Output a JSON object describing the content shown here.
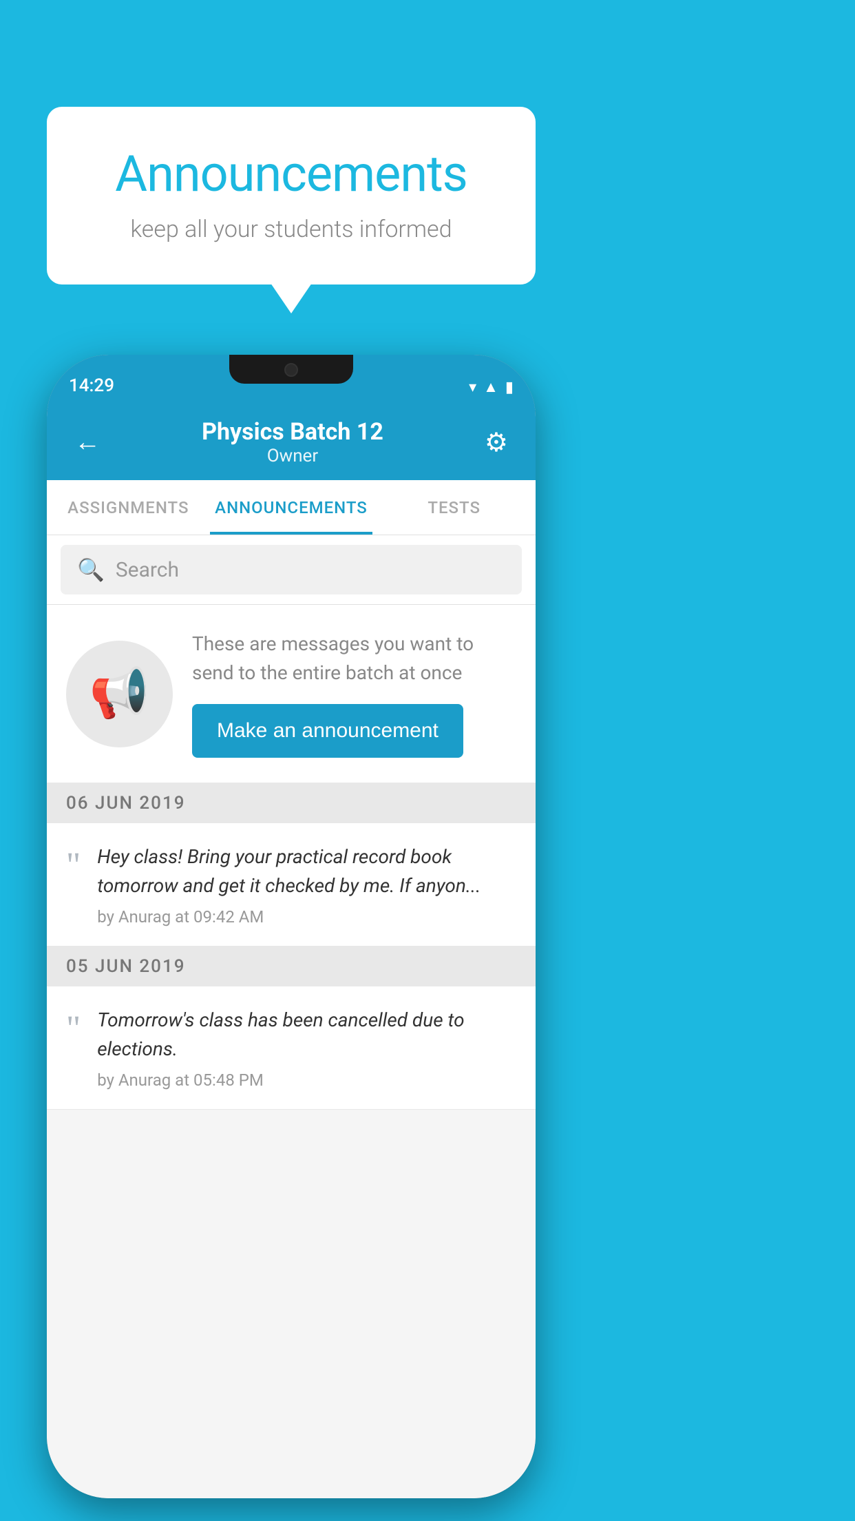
{
  "background_color": "#1cb8e0",
  "speech_bubble": {
    "title": "Announcements",
    "subtitle": "keep all your students informed"
  },
  "phone": {
    "status_bar": {
      "time": "14:29",
      "icons": [
        "wifi",
        "signal",
        "battery"
      ]
    },
    "header": {
      "title": "Physics Batch 12",
      "subtitle": "Owner",
      "back_label": "←",
      "gear_label": "⚙"
    },
    "tabs": [
      {
        "label": "ASSIGNMENTS",
        "active": false
      },
      {
        "label": "ANNOUNCEMENTS",
        "active": true
      },
      {
        "label": "TESTS",
        "active": false
      }
    ],
    "search": {
      "placeholder": "Search"
    },
    "promo": {
      "description": "These are messages you want to send to the entire batch at once",
      "button_label": "Make an announcement"
    },
    "announcements": [
      {
        "date": "06  JUN  2019",
        "text": "Hey class! Bring your practical record book tomorrow and get it checked by me. If anyon...",
        "meta": "by Anurag at 09:42 AM"
      },
      {
        "date": "05  JUN  2019",
        "text": "Tomorrow's class has been cancelled due to elections.",
        "meta": "by Anurag at 05:48 PM"
      }
    ]
  }
}
